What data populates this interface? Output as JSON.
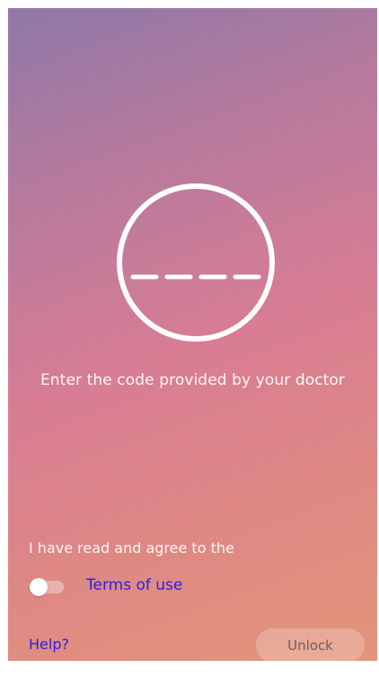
{
  "colors": {
    "gradient_top": "#8e78a8",
    "gradient_middle": "#d87d94",
    "gradient_bottom": "#e4957a",
    "link": "#2a1ee0",
    "text": "#ffffff"
  },
  "code_entry": {
    "icon": "code-circle-icon",
    "placeholder": "----"
  },
  "prompt": "Enter the code provided by your doctor",
  "terms": {
    "agree_text": "I have read and agree to the",
    "toggle_on": false,
    "link_label": "Terms of use"
  },
  "footer": {
    "help_label": "Help?",
    "unlock_label": "Unlock"
  }
}
